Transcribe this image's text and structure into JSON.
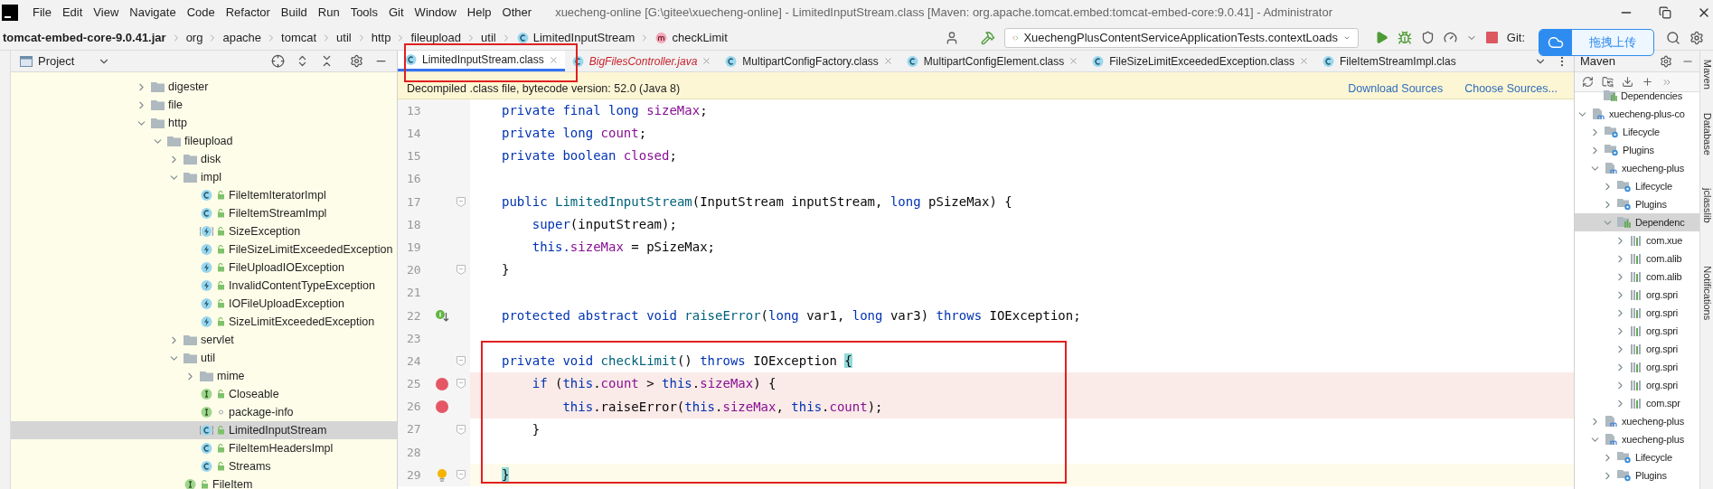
{
  "window": {
    "title": "xuecheng-online [G:\\gitee\\xuecheng-online] - LimitedInputStream.class [Maven: org.apache.tomcat.embed:tomcat-embed-core:9.0.41] - Administrator"
  },
  "menu": [
    "File",
    "Edit",
    "View",
    "Navigate",
    "Code",
    "Refactor",
    "Build",
    "Run",
    "Tools",
    "Git",
    "Window",
    "Help",
    "Other"
  ],
  "breadcrumbs": [
    {
      "label": "tomcat-embed-core-9.0.41.jar",
      "kind": "jar"
    },
    {
      "label": "org",
      "kind": "package"
    },
    {
      "label": "apache",
      "kind": "package"
    },
    {
      "label": "tomcat",
      "kind": "package"
    },
    {
      "label": "util",
      "kind": "package"
    },
    {
      "label": "http",
      "kind": "package"
    },
    {
      "label": "fileupload",
      "kind": "package"
    },
    {
      "label": "util",
      "kind": "package"
    },
    {
      "label": "LimitedInputStream",
      "kind": "class"
    },
    {
      "label": "checkLimit",
      "kind": "method"
    }
  ],
  "toolbar": {
    "run_config": "XuechengPlusContentServiceApplicationTests.contextLoads",
    "vcs_label": "Git:"
  },
  "upload_popup": {
    "label": "拖拽上传"
  },
  "project_panel": {
    "title": "Project",
    "tree": [
      {
        "label": "digester",
        "kind": "folder",
        "expanded": false,
        "selected": false
      },
      {
        "label": "file",
        "kind": "folder",
        "expanded": false,
        "selected": false
      },
      {
        "label": "http",
        "kind": "folder",
        "expanded": true,
        "selected": false,
        "children": [
          {
            "label": "fileupload",
            "kind": "folder",
            "expanded": true,
            "selected": false,
            "children": [
              {
                "label": "disk",
                "kind": "folder",
                "expanded": false,
                "selected": false
              },
              {
                "label": "impl",
                "kind": "folder",
                "expanded": true,
                "selected": false,
                "children": [
                  {
                    "label": "FileItemIteratorImpl",
                    "kind": "class",
                    "public": true,
                    "selected": false
                  },
                  {
                    "label": "FileItemStreamImpl",
                    "kind": "class",
                    "public": true,
                    "selected": false
                  },
                  {
                    "label": "SizeException",
                    "kind": "abstract-exception",
                    "public": true,
                    "selected": false
                  },
                  {
                    "label": "FileSizeLimitExceededException",
                    "kind": "exception",
                    "public": true,
                    "selected": false
                  },
                  {
                    "label": "FileUploadIOException",
                    "kind": "exception",
                    "public": true,
                    "selected": false
                  },
                  {
                    "label": "InvalidContentTypeException",
                    "kind": "exception",
                    "public": true,
                    "selected": false
                  },
                  {
                    "label": "IOFileUploadException",
                    "kind": "exception",
                    "public": true,
                    "selected": false
                  },
                  {
                    "label": "SizeLimitExceededException",
                    "kind": "exception",
                    "public": true,
                    "selected": false
                  }
                ]
              },
              {
                "label": "servlet",
                "kind": "folder",
                "expanded": false,
                "selected": false
              },
              {
                "label": "util",
                "kind": "folder",
                "expanded": true,
                "selected": false,
                "children": [
                  {
                    "label": "mime",
                    "kind": "folder",
                    "expanded": false,
                    "selected": false
                  },
                  {
                    "label": "Closeable",
                    "kind": "interface",
                    "public": true,
                    "selected": false
                  },
                  {
                    "label": "package-info",
                    "kind": "interface",
                    "public": false,
                    "selected": false
                  },
                  {
                    "label": "LimitedInputStream",
                    "kind": "abstract-class",
                    "public": true,
                    "selected": true
                  },
                  {
                    "label": "FileItemHeadersImpl",
                    "kind": "class",
                    "public": true,
                    "selected": false
                  },
                  {
                    "label": "Streams",
                    "kind": "class",
                    "public": true,
                    "selected": false
                  }
                ]
              },
              {
                "label": "FileItem",
                "kind": "interface",
                "public": true,
                "selected": false
              }
            ]
          }
        ]
      }
    ]
  },
  "editor": {
    "tabs": [
      {
        "label": "LimitedInputStream.class",
        "kind": "class",
        "selected": true
      },
      {
        "label": "BigFilesController.java",
        "kind": "source",
        "selected": false
      },
      {
        "label": "MultipartConfigFactory.class",
        "kind": "class",
        "selected": false
      },
      {
        "label": "MultipartConfigElement.class",
        "kind": "class",
        "selected": false
      },
      {
        "label": "FileSizeLimitExceededException.class",
        "kind": "class",
        "selected": false
      },
      {
        "label": "FileItemStreamImpl.clas",
        "kind": "class",
        "selected": false
      }
    ],
    "banner": {
      "text": "Decompiled .class file, bytecode version: 52.0 (Java 8)",
      "links": [
        "Download Sources",
        "Choose Sources..."
      ]
    },
    "lines": [
      {
        "n": "13",
        "fold": false,
        "breakpoint": false,
        "current": false,
        "tokens": [
          {
            "kind": "kw",
            "text": "private final long "
          },
          {
            "kind": "field",
            "text": "sizeMax"
          },
          {
            "kind": "plain",
            "text": ";"
          }
        ]
      },
      {
        "n": "14",
        "fold": false,
        "breakpoint": false,
        "current": false,
        "tokens": [
          {
            "kind": "kw",
            "text": "private long "
          },
          {
            "kind": "field",
            "text": "count"
          },
          {
            "kind": "plain",
            "text": ";"
          }
        ]
      },
      {
        "n": "15",
        "fold": false,
        "breakpoint": false,
        "current": false,
        "tokens": [
          {
            "kind": "kw",
            "text": "private boolean "
          },
          {
            "kind": "field",
            "text": "closed"
          },
          {
            "kind": "plain",
            "text": ";"
          }
        ]
      },
      {
        "n": "16",
        "fold": false,
        "breakpoint": false,
        "current": false
      },
      {
        "n": "17",
        "fold": true,
        "breakpoint": false,
        "current": false,
        "tokens": [
          {
            "kind": "kw",
            "text": "public "
          },
          {
            "kind": "fn",
            "text": "LimitedInputStream"
          },
          {
            "kind": "plain",
            "text": "(InputStream inputStream, "
          },
          {
            "kind": "kw",
            "text": "long"
          },
          {
            "kind": "plain",
            "text": " pSizeMax) {"
          }
        ]
      },
      {
        "n": "18",
        "fold": false,
        "breakpoint": false,
        "current": false,
        "tokens": [
          {
            "kind": "kw",
            "text": "    super"
          },
          {
            "kind": "plain",
            "text": "(inputStream);"
          }
        ]
      },
      {
        "n": "19",
        "fold": false,
        "breakpoint": false,
        "current": false,
        "tokens": [
          {
            "kind": "kw",
            "text": "    this."
          },
          {
            "kind": "field",
            "text": "sizeMax"
          },
          {
            "kind": "plain",
            "text": " = pSizeMax;"
          }
        ]
      },
      {
        "n": "20",
        "fold": true,
        "breakpoint": false,
        "current": false,
        "tokens": [
          {
            "kind": "plain",
            "text": "}"
          }
        ]
      },
      {
        "n": "21",
        "fold": false,
        "breakpoint": false,
        "current": false
      },
      {
        "n": "22",
        "fold": false,
        "breakpoint": false,
        "current": false,
        "gutter": {
          "kind": "implemented"
        },
        "tokens": [
          {
            "kind": "kw",
            "text": "protected abstract void "
          },
          {
            "kind": "fn",
            "text": "raiseError"
          },
          {
            "kind": "plain",
            "text": "("
          },
          {
            "kind": "kw",
            "text": "long"
          },
          {
            "kind": "plain",
            "text": " var1, "
          },
          {
            "kind": "kw",
            "text": "long"
          },
          {
            "kind": "plain",
            "text": " var3) "
          },
          {
            "kind": "kw",
            "text": "throws"
          },
          {
            "kind": "plain",
            "text": " IOException;"
          }
        ]
      },
      {
        "n": "23",
        "fold": false,
        "breakpoint": false,
        "current": false
      },
      {
        "n": "24",
        "fold": true,
        "breakpoint": false,
        "current": false,
        "tokens": [
          {
            "kind": "kw",
            "text": "private void "
          },
          {
            "kind": "fn",
            "text": "checkLimit"
          },
          {
            "kind": "plain",
            "text": "() "
          },
          {
            "kind": "kw",
            "text": "throws"
          },
          {
            "kind": "plain",
            "text": " IOException "
          },
          {
            "kind": "match",
            "text": "{"
          }
        ]
      },
      {
        "n": "25",
        "fold": true,
        "breakpoint": true,
        "current": false,
        "tokens": [
          {
            "kind": "kw",
            "text": "    if"
          },
          {
            "kind": "plain",
            "text": " ("
          },
          {
            "kind": "kw",
            "text": "this"
          },
          {
            "kind": "plain",
            "text": "."
          },
          {
            "kind": "field",
            "text": "count"
          },
          {
            "kind": "plain",
            "text": " > "
          },
          {
            "kind": "kw",
            "text": "this"
          },
          {
            "kind": "plain",
            "text": "."
          },
          {
            "kind": "field",
            "text": "sizeMax"
          },
          {
            "kind": "plain",
            "text": ") {"
          }
        ]
      },
      {
        "n": "26",
        "fold": false,
        "breakpoint": true,
        "current": false,
        "tokens": [
          {
            "kind": "kw",
            "text": "        this"
          },
          {
            "kind": "plain",
            "text": ".raiseError("
          },
          {
            "kind": "kw",
            "text": "this"
          },
          {
            "kind": "plain",
            "text": "."
          },
          {
            "kind": "field",
            "text": "sizeMax"
          },
          {
            "kind": "plain",
            "text": ", "
          },
          {
            "kind": "kw",
            "text": "this"
          },
          {
            "kind": "plain",
            "text": "."
          },
          {
            "kind": "field",
            "text": "count"
          },
          {
            "kind": "plain",
            "text": ");"
          }
        ]
      },
      {
        "n": "27",
        "fold": true,
        "breakpoint": false,
        "current": false,
        "tokens": [
          {
            "kind": "plain",
            "text": "    }"
          }
        ]
      },
      {
        "n": "28",
        "fold": false,
        "breakpoint": false,
        "current": false
      },
      {
        "n": "29",
        "fold": true,
        "breakpoint": false,
        "current": true,
        "gutter": {
          "kind": "bulb"
        },
        "tokens": [
          {
            "kind": "match",
            "text": "}"
          }
        ]
      }
    ]
  },
  "maven_panel": {
    "title": "Maven",
    "partial_row": {
      "label": "Dependencies",
      "kind": "deps"
    },
    "tree": [
      {
        "label": "xuecheng-plus-co",
        "kind": "module",
        "expanded": true,
        "selected": false,
        "children": [
          {
            "label": "Lifecycle",
            "kind": "lifecycle",
            "expanded": false,
            "selected": false
          },
          {
            "label": "Plugins",
            "kind": "plugins",
            "expanded": false,
            "selected": false
          },
          {
            "label": "xuecheng-plus",
            "kind": "module",
            "expanded": true,
            "selected": false,
            "children": [
              {
                "label": "Lifecycle",
                "kind": "lifecycle",
                "expanded": false,
                "selected": false
              },
              {
                "label": "Plugins",
                "kind": "plugins",
                "expanded": false,
                "selected": false
              },
              {
                "label": "Dependenc",
                "kind": "deps",
                "expanded": true,
                "selected": true,
                "children": [
                  {
                    "label": "com.xue",
                    "kind": "lib",
                    "expanded": false,
                    "selected": false
                  },
                  {
                    "label": "com.alib",
                    "kind": "lib",
                    "expanded": false,
                    "selected": false
                  },
                  {
                    "label": "com.alib",
                    "kind": "lib",
                    "expanded": false,
                    "selected": false
                  },
                  {
                    "label": "org.spri",
                    "kind": "lib",
                    "expanded": false,
                    "selected": false
                  },
                  {
                    "label": "org.spri",
                    "kind": "lib",
                    "expanded": false,
                    "selected": false
                  },
                  {
                    "label": "org.spri",
                    "kind": "lib",
                    "expanded": false,
                    "selected": false
                  },
                  {
                    "label": "org.spri",
                    "kind": "lib",
                    "expanded": false,
                    "selected": false
                  },
                  {
                    "label": "org.spri",
                    "kind": "lib",
                    "expanded": false,
                    "selected": false
                  },
                  {
                    "label": "org.spri",
                    "kind": "lib",
                    "expanded": false,
                    "selected": false
                  },
                  {
                    "label": "com.spr",
                    "kind": "lib",
                    "expanded": false,
                    "selected": false
                  }
                ]
              }
            ]
          },
          {
            "label": "xuecheng-plus",
            "kind": "module",
            "expanded": false,
            "selected": false
          },
          {
            "label": "xuecheng-plus",
            "kind": "module",
            "expanded": true,
            "selected": false,
            "children": [
              {
                "label": "Lifecycle",
                "kind": "lifecycle",
                "expanded": false,
                "selected": false
              },
              {
                "label": "Plugins",
                "kind": "plugins",
                "expanded": false,
                "selected": false
              }
            ]
          }
        ]
      }
    ]
  },
  "side_tabs": [
    "Maven",
    "Database",
    "jclasslib",
    "Notifications"
  ]
}
